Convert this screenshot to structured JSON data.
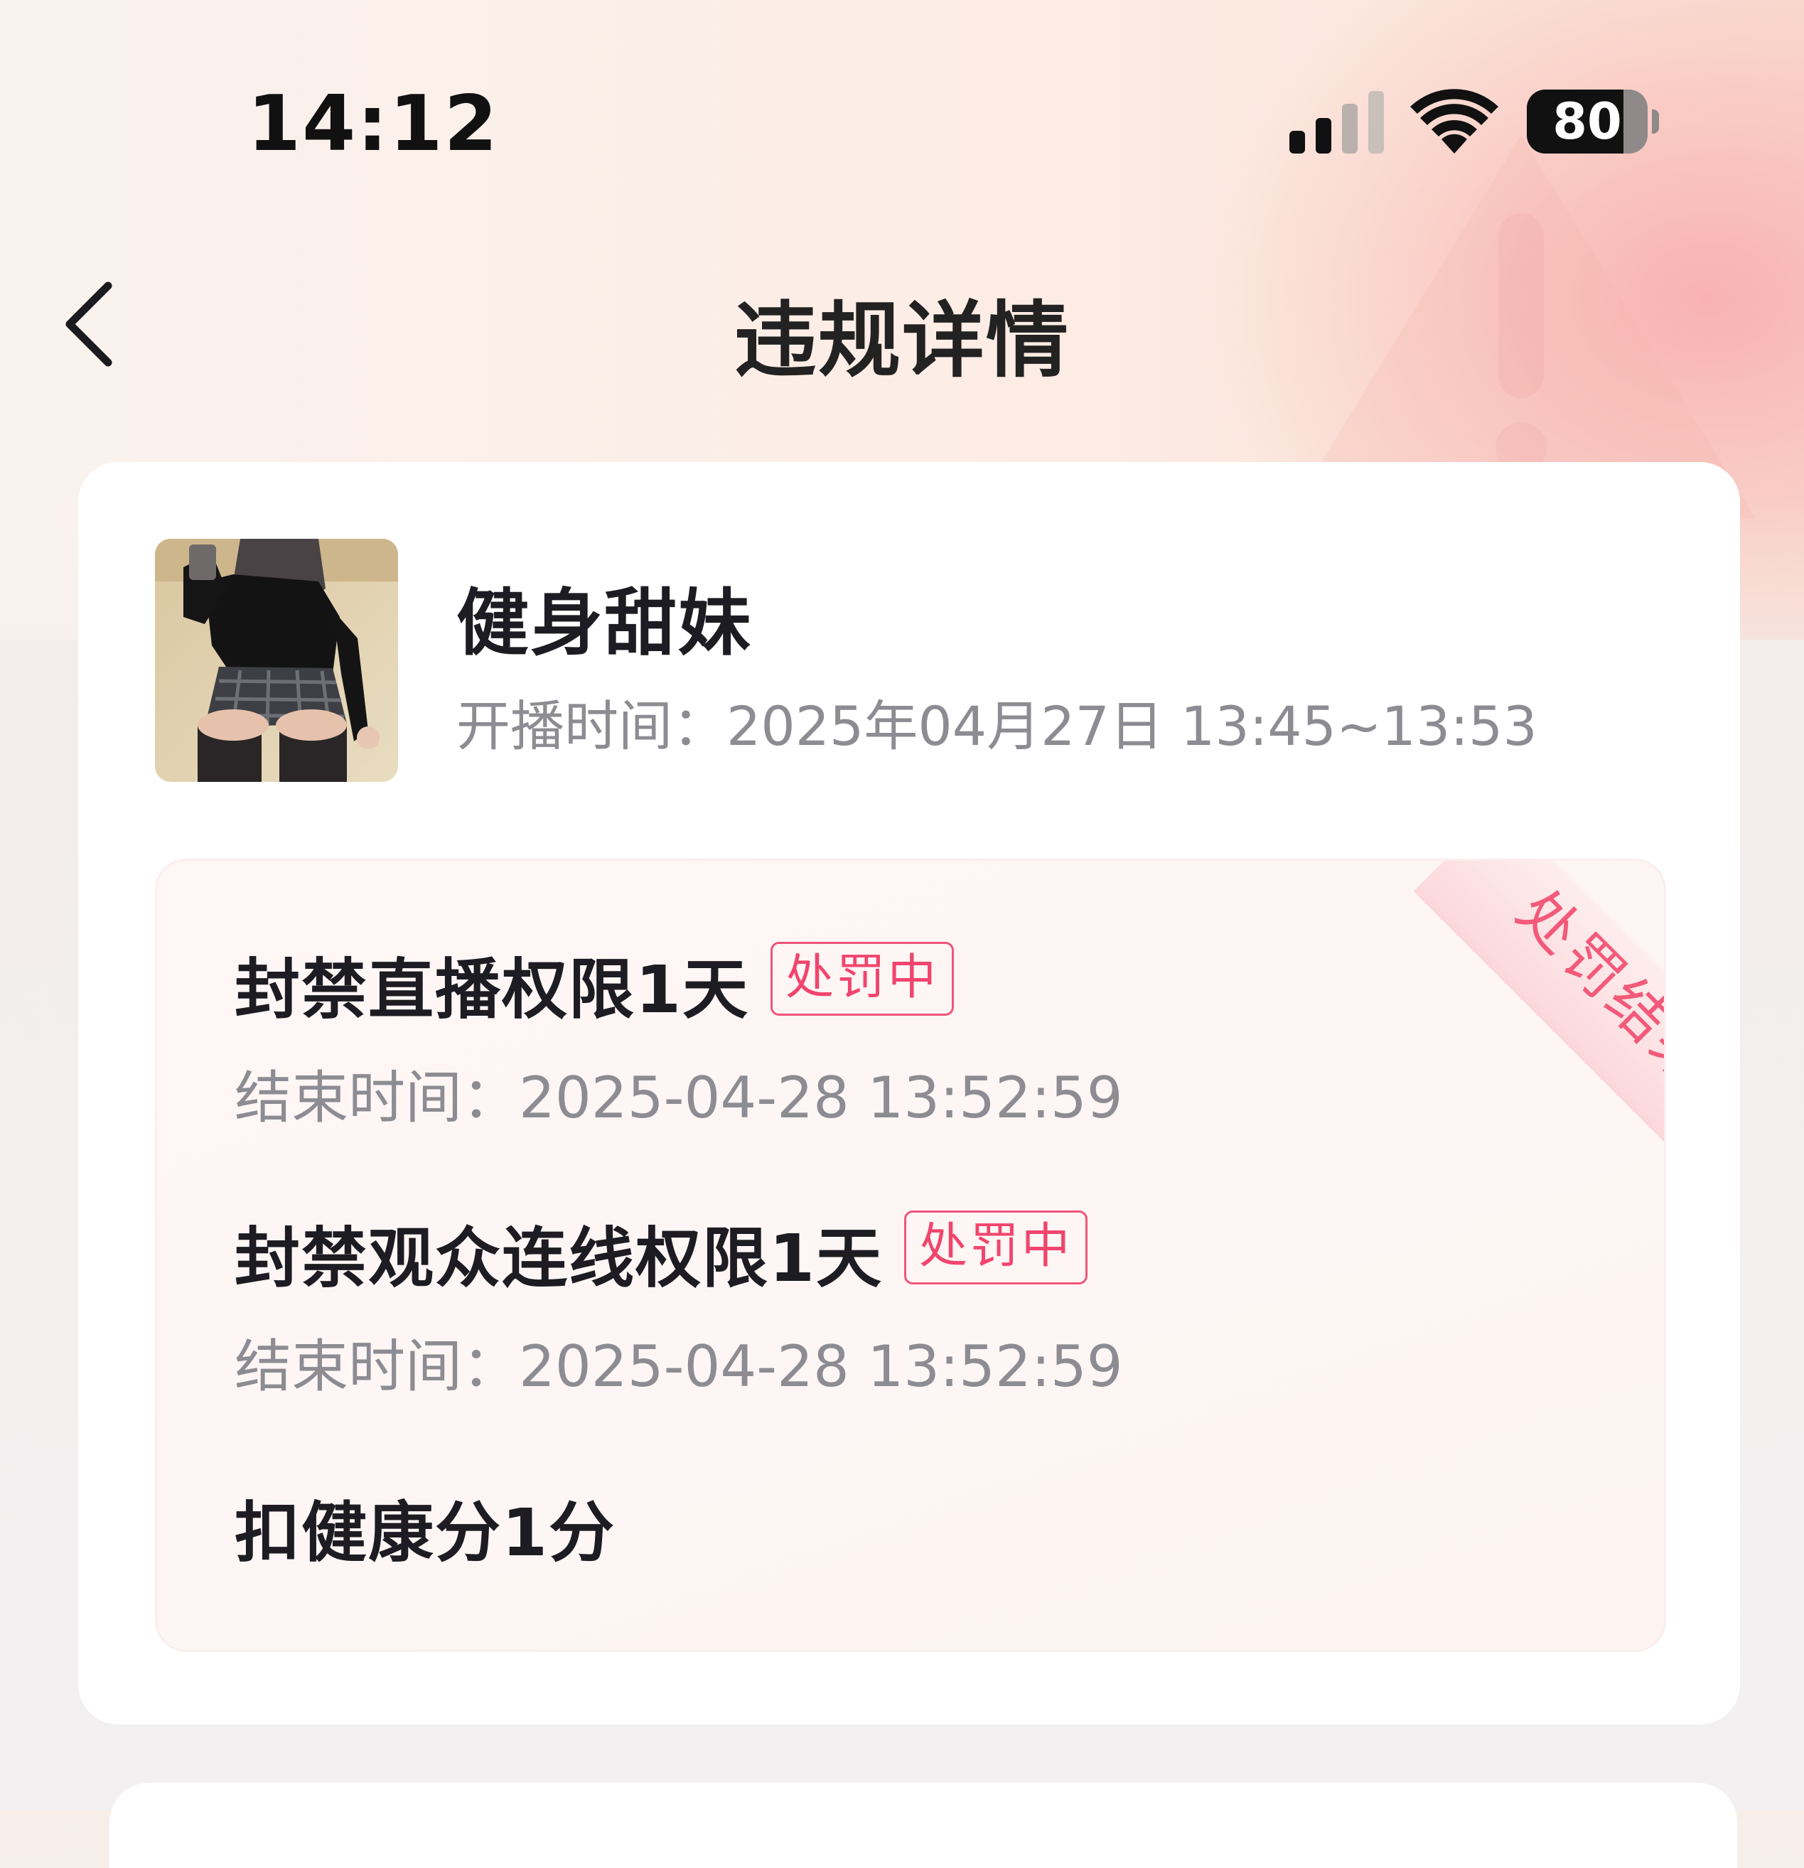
{
  "status_bar": {
    "time": "14:12",
    "battery_level": "80",
    "signal_icon": "cellular-signal-icon",
    "wifi_icon": "wifi-icon"
  },
  "nav": {
    "back_icon": "chevron-left-icon",
    "title": "违规详情"
  },
  "streamer": {
    "name": "健身甜妹",
    "stream_time_label": "开播时间：",
    "stream_time_value": "2025年04月27日 13:45~13:53",
    "avatar_icon": "avatar-photo"
  },
  "penalty": {
    "ribbon_label": "处罚结果",
    "items": [
      {
        "title": "封禁直播权限1天",
        "status": "处罚中",
        "end_label": "结束时间：",
        "end_value": "2025-04-28 13:52:59"
      },
      {
        "title": "封禁观众连线权限1天",
        "status": "处罚中",
        "end_label": "结束时间：",
        "end_value": "2025-04-28 13:52:59"
      },
      {
        "title": "扣健康分1分"
      }
    ]
  },
  "colors": {
    "accent": "#f1456e",
    "muted_text": "#8c8c92",
    "card_bg": "#ffffff"
  }
}
